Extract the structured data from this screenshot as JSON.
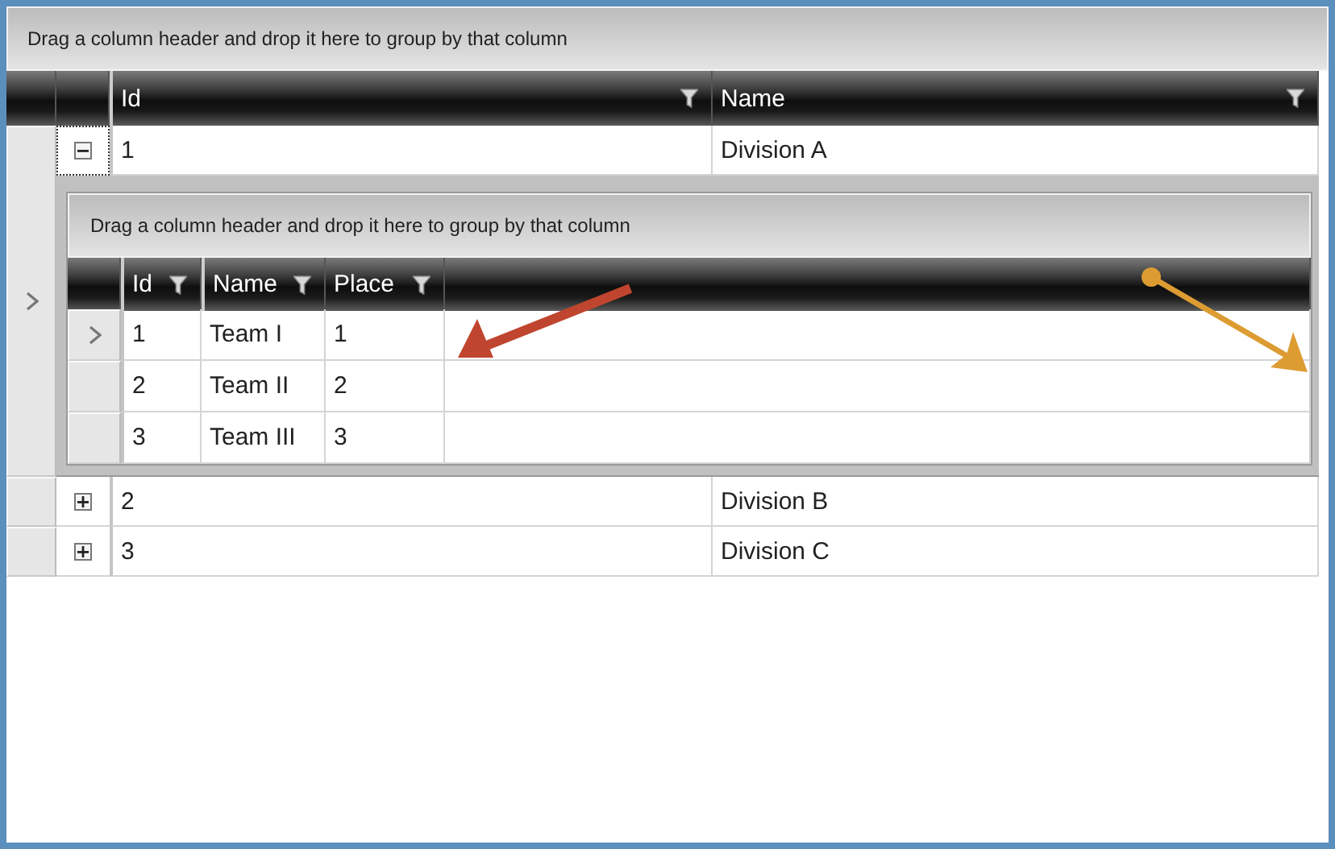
{
  "grid": {
    "group_panel": "Drag a column header and drop it here to group by that column",
    "columns": [
      {
        "label": "Id"
      },
      {
        "label": "Name"
      }
    ],
    "rows": [
      {
        "id": "1",
        "name": "Division A",
        "expanded": true,
        "current": true,
        "detail": {
          "group_panel": "Drag a column header and drop it here to group by that column",
          "columns": [
            {
              "label": "Id"
            },
            {
              "label": "Name"
            },
            {
              "label": "Place"
            }
          ],
          "rows": [
            {
              "id": "1",
              "name": "Team I",
              "place": "1",
              "current": true
            },
            {
              "id": "2",
              "name": "Team II",
              "place": "2",
              "current": false
            },
            {
              "id": "3",
              "name": "Team III",
              "place": "3",
              "current": false
            }
          ]
        }
      },
      {
        "id": "2",
        "name": "Division B",
        "expanded": false,
        "current": false
      },
      {
        "id": "3",
        "name": "Division C",
        "expanded": false,
        "current": false
      }
    ]
  },
  "annotations": [
    {
      "kind": "arrow",
      "color": "#c0452e"
    },
    {
      "kind": "dot-arrow",
      "color": "#dc9c32"
    }
  ]
}
